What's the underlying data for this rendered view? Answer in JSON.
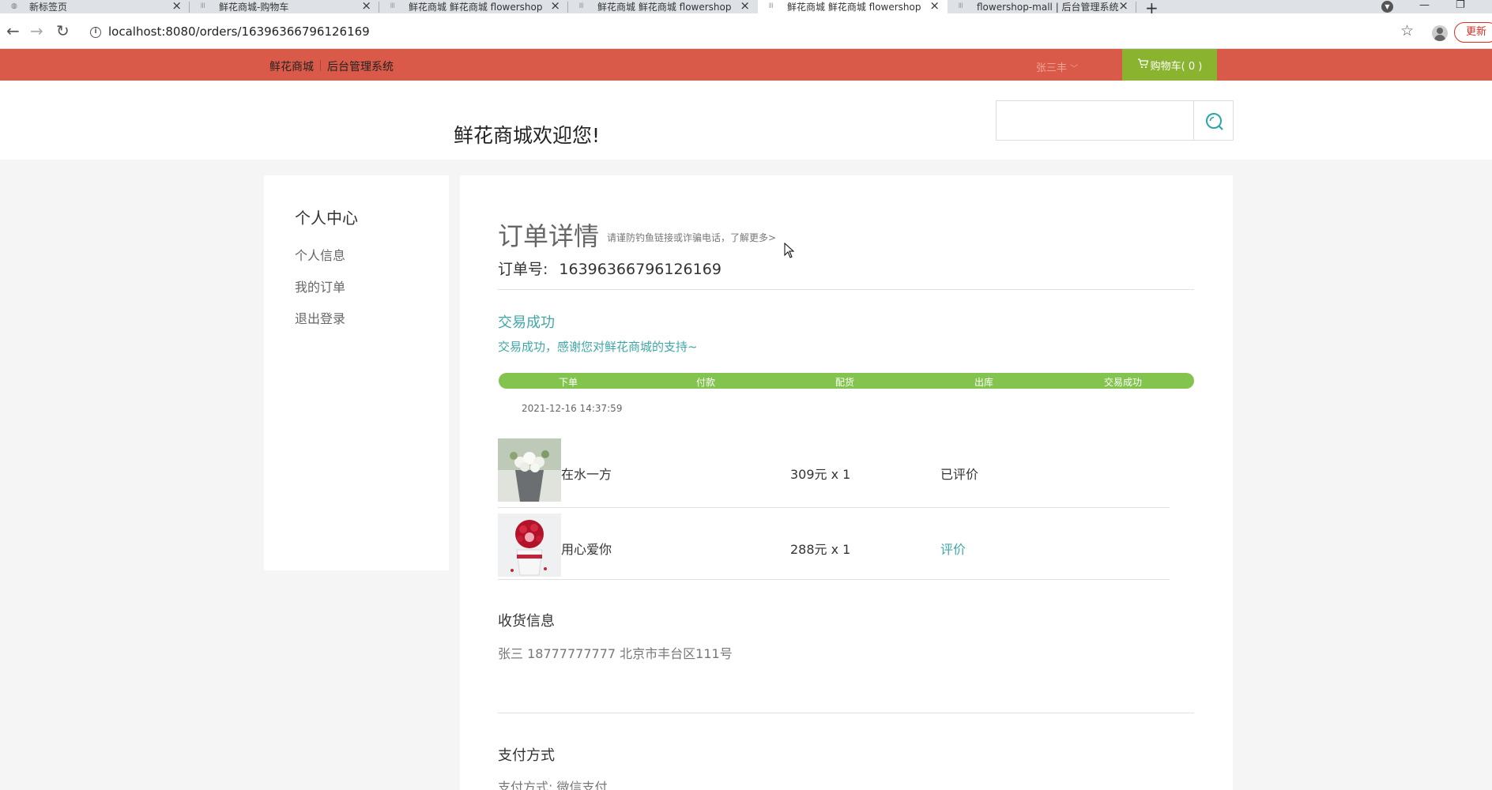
{
  "browser": {
    "tabs": [
      {
        "label": "新标签页"
      },
      {
        "label": "鲜花商城-购物车"
      },
      {
        "label": "鲜花商城 鲜花商城 flowershop"
      },
      {
        "label": "鲜花商城 鲜花商城 flowershop"
      },
      {
        "label": "鲜花商城 鲜花商城 flowershop"
      },
      {
        "label": "flowershop-mall | 后台管理系统"
      }
    ],
    "url": "localhost:8080/orders/16396366796126169",
    "update_label": "更新"
  },
  "topbar": {
    "link_shop": "鲜花商城",
    "link_admin": "后台管理系统",
    "user_name": "张三丰",
    "cart_label": "购物车( 0 )"
  },
  "header": {
    "welcome": "鲜花商城欢迎您!",
    "search_value": ""
  },
  "sidebar": {
    "title": "个人中心",
    "items": [
      "个人信息",
      "我的订单",
      "退出登录"
    ]
  },
  "order": {
    "title": "订单详情",
    "tip": "请谨防钓鱼链接或诈骗电话，了解更多>",
    "number_label": "订单号:",
    "number": "16396366796126169",
    "status": "交易成功",
    "status_message": "交易成功，感谢您对鲜花商城的支持~",
    "steps": [
      "下单",
      "付款",
      "配货",
      "出库",
      "交易成功"
    ],
    "progress_fraction": 1.0,
    "time": "2021-12-16 14:37:59",
    "items": [
      {
        "name": "在水一方",
        "price": "309元 x 1",
        "status": "已评价"
      },
      {
        "name": "用心爱你",
        "price": "288元 x 1",
        "status": "评价"
      }
    ],
    "shipping_title": "收货信息",
    "shipping_info": "张三 18777777777 北京市丰台区111号",
    "payment_title": "支付方式",
    "payment_info": "支付方式: 微信支付"
  },
  "colors": {
    "topbar_bg": "#da5a49",
    "cart_bg": "#8ab32f",
    "accent": "#3fa7a8",
    "progress": "#83c44e"
  }
}
